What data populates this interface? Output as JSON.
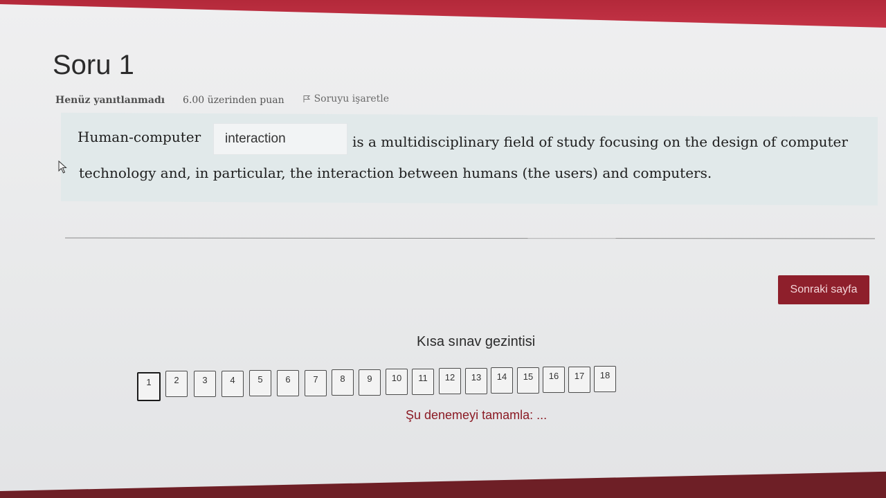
{
  "question": {
    "title": "Soru 1",
    "status": "Henüz yanıtlanmadı",
    "points": "6.00 üzerinden puan",
    "flag_label": "Soruyu işaretle",
    "text_before": "Human-computer",
    "answer_value": "interaction",
    "text_after_line1": "is a multidisciplinary field of study focusing on the design of computer",
    "text_line2": "technology and, in particular, the interaction between humans (the users) and computers."
  },
  "next_button_label": "Sonraki sayfa",
  "quiz_navigation": {
    "title": "Kısa sınav gezintisi",
    "buttons": [
      "1",
      "2",
      "3",
      "4",
      "5",
      "6",
      "7",
      "8",
      "9",
      "10",
      "11",
      "12",
      "13",
      "14",
      "15",
      "16",
      "17",
      "18"
    ],
    "current": "1",
    "finish_link": "Şu denemeyi tamamla: ..."
  },
  "colors": {
    "accent": "#8e1f2b",
    "question_bg": "#e1e9ea"
  }
}
